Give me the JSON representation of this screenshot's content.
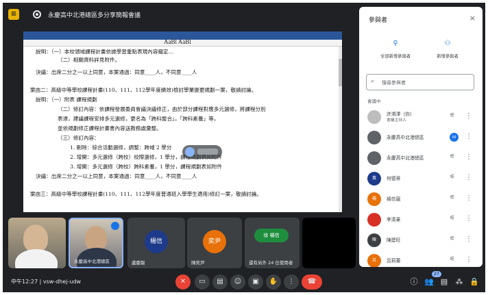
{
  "meeting": {
    "title": "永慶高中北港總區多分享簡報會議",
    "time": "中午12:27",
    "code": "vsw-dhej-udw"
  },
  "document": {
    "font_label": "AaBl AaBl",
    "lines": [
      "說明：（一）本校領域課程計畫依據學習重點表現內容擬定…",
      "（二）相關資料詳見附件。",
      "決議：出席二分之一以上同意，本案通過：同意____人，不同意____人",
      "案由二：高級中等學校課程計畫(110、111、112學年度績效)檢討學業變更規劃一案，敬請討論。",
      "說明：（一）附表 課程規劃",
      "（二）修訂內容：依課程發展委員會議決議修正，由於部分課程對應多元選修，將課程分別",
      "    表達，建議課程安排多元選修，更名為「跨科整合」，「跨科素養」等，",
      "    並依規劃修正課程計畫書內容送教務處彙整。",
      "（三）修訂內容：",
      "1.  刪除：綜合活動選修，調整：跨域 2 學分",
      "2.  增開：多元選修（跨校）校際選修，1 學分，課程規劃表如附件",
      "3.  增開：多元選修（跨校）跨科素養，1 學分，課程規劃表如附件",
      "決議：出席二分之一以上同意，本案通過：同意____人，不同意____人",
      "案由三：高級中等學校課程計畫(110、111、112學年度普通班入學學生適用)修訂一案，敬請討論。"
    ]
  },
  "tiles": [
    {
      "label": "",
      "initials": ""
    },
    {
      "label": "永慶高中北港總區",
      "initials": ""
    },
    {
      "label": "盧慶龍",
      "initials": "楊信"
    },
    {
      "label": "陳奕尹",
      "initials": "奕尹"
    },
    {
      "label": "還有另外 24 位使用者",
      "initials": "徐 楊信"
    },
    {
      "label": "",
      "initials": ""
    }
  ],
  "controls": {
    "participant_count": "27"
  },
  "panel": {
    "title": "參與者",
    "close": "×",
    "add_label": "全部新增參與者",
    "host_label": "新增參與者",
    "search_placeholder": "搜尋參與者",
    "section": "會議中",
    "participants": [
      {
        "name": "許鴻澤（你）",
        "sub": "會議主持人",
        "initials": "",
        "color": "#bdbdbd",
        "mic": "muted"
      },
      {
        "name": "永慶高中北港總區",
        "sub": "",
        "initials": "",
        "color": "#5f6368",
        "mic": "on"
      },
      {
        "name": "永慶高中北港總區",
        "sub": "",
        "initials": "",
        "color": "#5f6368",
        "mic": "muted"
      },
      {
        "name": "何德蒂",
        "sub": "",
        "initials": "黃",
        "color": "#1e3a8a",
        "mic": "muted"
      },
      {
        "name": "楊信龍",
        "sub": "",
        "initials": "楊",
        "color": "#e8710a",
        "mic": "muted"
      },
      {
        "name": "李清豪",
        "sub": "",
        "initials": "",
        "color": "#d93025",
        "mic": "muted"
      },
      {
        "name": "陳建旺",
        "sub": "",
        "initials": "陳",
        "color": "#3c4043",
        "mic": "muted"
      },
      {
        "name": "呂莉蓁",
        "sub": "",
        "initials": "呂",
        "color": "#e8710a",
        "mic": "muted"
      }
    ]
  }
}
